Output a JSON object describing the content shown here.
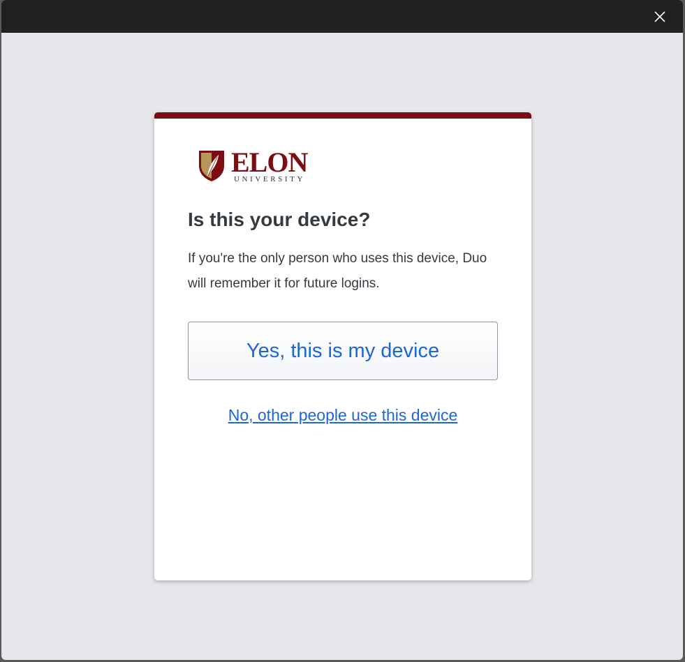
{
  "window": {
    "close_icon": "close-icon"
  },
  "card": {
    "accent_color": "#7b0d13",
    "logo": {
      "wordmark": "ELON",
      "subword": "UNIVERSITY",
      "icon": "shield-leaf-icon"
    },
    "title": "Is this your device?",
    "description": "If you're the only person who uses this device, Duo will remember it for future logins.",
    "yes_button_label": "Yes, this is my device",
    "no_link_label": "No, other people use this device",
    "link_color": "#1b67d5"
  }
}
